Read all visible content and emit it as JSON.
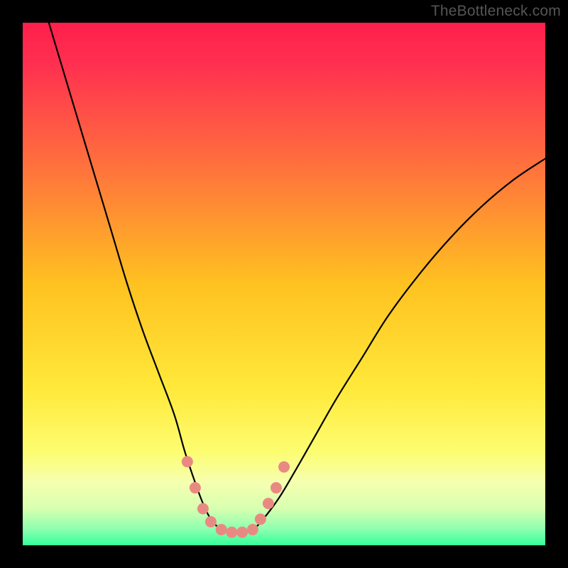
{
  "watermark": "TheBottleneck.com",
  "chart_data": {
    "type": "line",
    "title": "",
    "xlabel": "",
    "ylabel": "",
    "xlim": [
      0,
      100
    ],
    "ylim": [
      0,
      100
    ],
    "background_gradient": {
      "stops": [
        {
          "pos": 0.0,
          "color": "#ff1f4b"
        },
        {
          "pos": 0.08,
          "color": "#ff3050"
        },
        {
          "pos": 0.3,
          "color": "#ff7a3a"
        },
        {
          "pos": 0.5,
          "color": "#ffc220"
        },
        {
          "pos": 0.7,
          "color": "#ffe93a"
        },
        {
          "pos": 0.82,
          "color": "#fdfd70"
        },
        {
          "pos": 0.88,
          "color": "#f5ffb0"
        },
        {
          "pos": 0.93,
          "color": "#d8ffb0"
        },
        {
          "pos": 0.97,
          "color": "#8bffb0"
        },
        {
          "pos": 1.0,
          "color": "#33ff99"
        }
      ]
    },
    "series": [
      {
        "name": "bottleneck-curve",
        "stroke": "#000000",
        "stroke_width": 2.2,
        "x": [
          5,
          8,
          11,
          14,
          17,
          20,
          23,
          26,
          29,
          31,
          33,
          34.5,
          36,
          38,
          40,
          42,
          44,
          46,
          49,
          52,
          56,
          60,
          65,
          70,
          76,
          82,
          88,
          94,
          100
        ],
        "y": [
          100,
          90,
          80,
          70,
          60,
          50,
          41,
          33,
          25,
          18,
          12,
          8,
          5,
          3,
          2.5,
          2.5,
          3,
          5,
          9,
          14,
          21,
          28,
          36,
          44,
          52,
          59,
          65,
          70,
          74
        ]
      }
    ],
    "markers": {
      "name": "highlight-dots",
      "color": "#e98a82",
      "radius_px": 8,
      "points": [
        {
          "x": 31.5,
          "y": 16
        },
        {
          "x": 33.0,
          "y": 11
        },
        {
          "x": 34.5,
          "y": 7
        },
        {
          "x": 36.0,
          "y": 4.5
        },
        {
          "x": 38.0,
          "y": 3
        },
        {
          "x": 40.0,
          "y": 2.5
        },
        {
          "x": 42.0,
          "y": 2.5
        },
        {
          "x": 44.0,
          "y": 3
        },
        {
          "x": 45.5,
          "y": 5
        },
        {
          "x": 47.0,
          "y": 8
        },
        {
          "x": 48.5,
          "y": 11
        },
        {
          "x": 50.0,
          "y": 15
        }
      ]
    }
  }
}
